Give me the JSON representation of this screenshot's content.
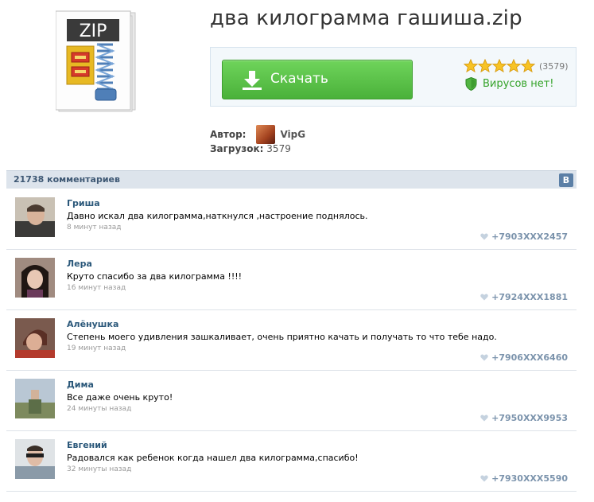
{
  "file": {
    "icon_label": "ZIP",
    "title": "два килограмма гашиша.zip"
  },
  "download": {
    "button_label": "Скачать",
    "rating_count": "(3579)",
    "stars": 5,
    "virus_status": "Вирусов нет!"
  },
  "meta": {
    "author_label": "Автор:",
    "author_name": "VipG",
    "downloads_label": "Загрузок:",
    "downloads_count": "3579"
  },
  "comments": {
    "header": "21738 комментариев",
    "vk_badge": "В",
    "items": [
      {
        "name": "Гриша",
        "text": "Давно искал два килограмма,наткнулся ,настроение поднялось.",
        "time": "8 минут назад",
        "phone": "+7903XXX2457"
      },
      {
        "name": "Лера",
        "text": "Круто спасибо за два килограмма !!!!",
        "time": "16 минут назад",
        "phone": "+7924XXX1881"
      },
      {
        "name": "Алёнушка",
        "text": "Степень моего удивления зашкаливает, очень приятно качать и получать то что тебе надо.",
        "time": "19 минут назад",
        "phone": "+7906XXX6460"
      },
      {
        "name": "Дима",
        "text": "Все даже очень круто!",
        "time": "24 минуты назад",
        "phone": "+7950XXX9953"
      },
      {
        "name": "Евгений",
        "text": "Радовался как ребенок когда нашел два килограмма,спасибо!",
        "time": "32 минуты назад",
        "phone": "+7930XXX5590"
      }
    ]
  },
  "colors": {
    "download_green": "#4ab13a",
    "virus_green": "#35a32a",
    "comment_name": "#2b587a",
    "header_bg": "#dde4ec"
  }
}
